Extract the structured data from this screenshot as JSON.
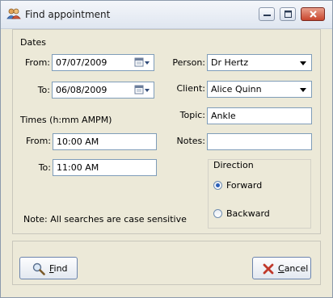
{
  "window": {
    "title": "Find appointment",
    "icon": "people-icon"
  },
  "dates": {
    "heading": "Dates",
    "from_label": "From:",
    "from_value": "07/07/2009",
    "to_label": "To:",
    "to_value": "06/08/2009"
  },
  "times": {
    "heading": "Times (h:mm AMPM)",
    "from_label": "From:",
    "from_value": "10:00 AM",
    "to_label": "To:",
    "to_value": "11:00 AM"
  },
  "person": {
    "label": "Person:",
    "value": "Dr Hertz"
  },
  "client": {
    "label": "Client:",
    "value": "Alice Quinn"
  },
  "topic": {
    "label": "Topic:",
    "value": "Ankle"
  },
  "notes": {
    "label": "Notes:",
    "value": ""
  },
  "direction": {
    "heading": "Direction",
    "options": [
      "Forward",
      "Backward"
    ],
    "selected": "Forward"
  },
  "note_text": "Note: All searches are case sensitive",
  "buttons": {
    "find_label": "Find",
    "find_mnemonic": "F",
    "find_rest": "ind",
    "cancel_label": "Cancel",
    "cancel_mnemonic": "C",
    "cancel_rest": "ancel"
  },
  "colors": {
    "selected_radio": "#2a5fb8",
    "cancel_icon": "#c0392b",
    "close_button": "#c8452c"
  }
}
